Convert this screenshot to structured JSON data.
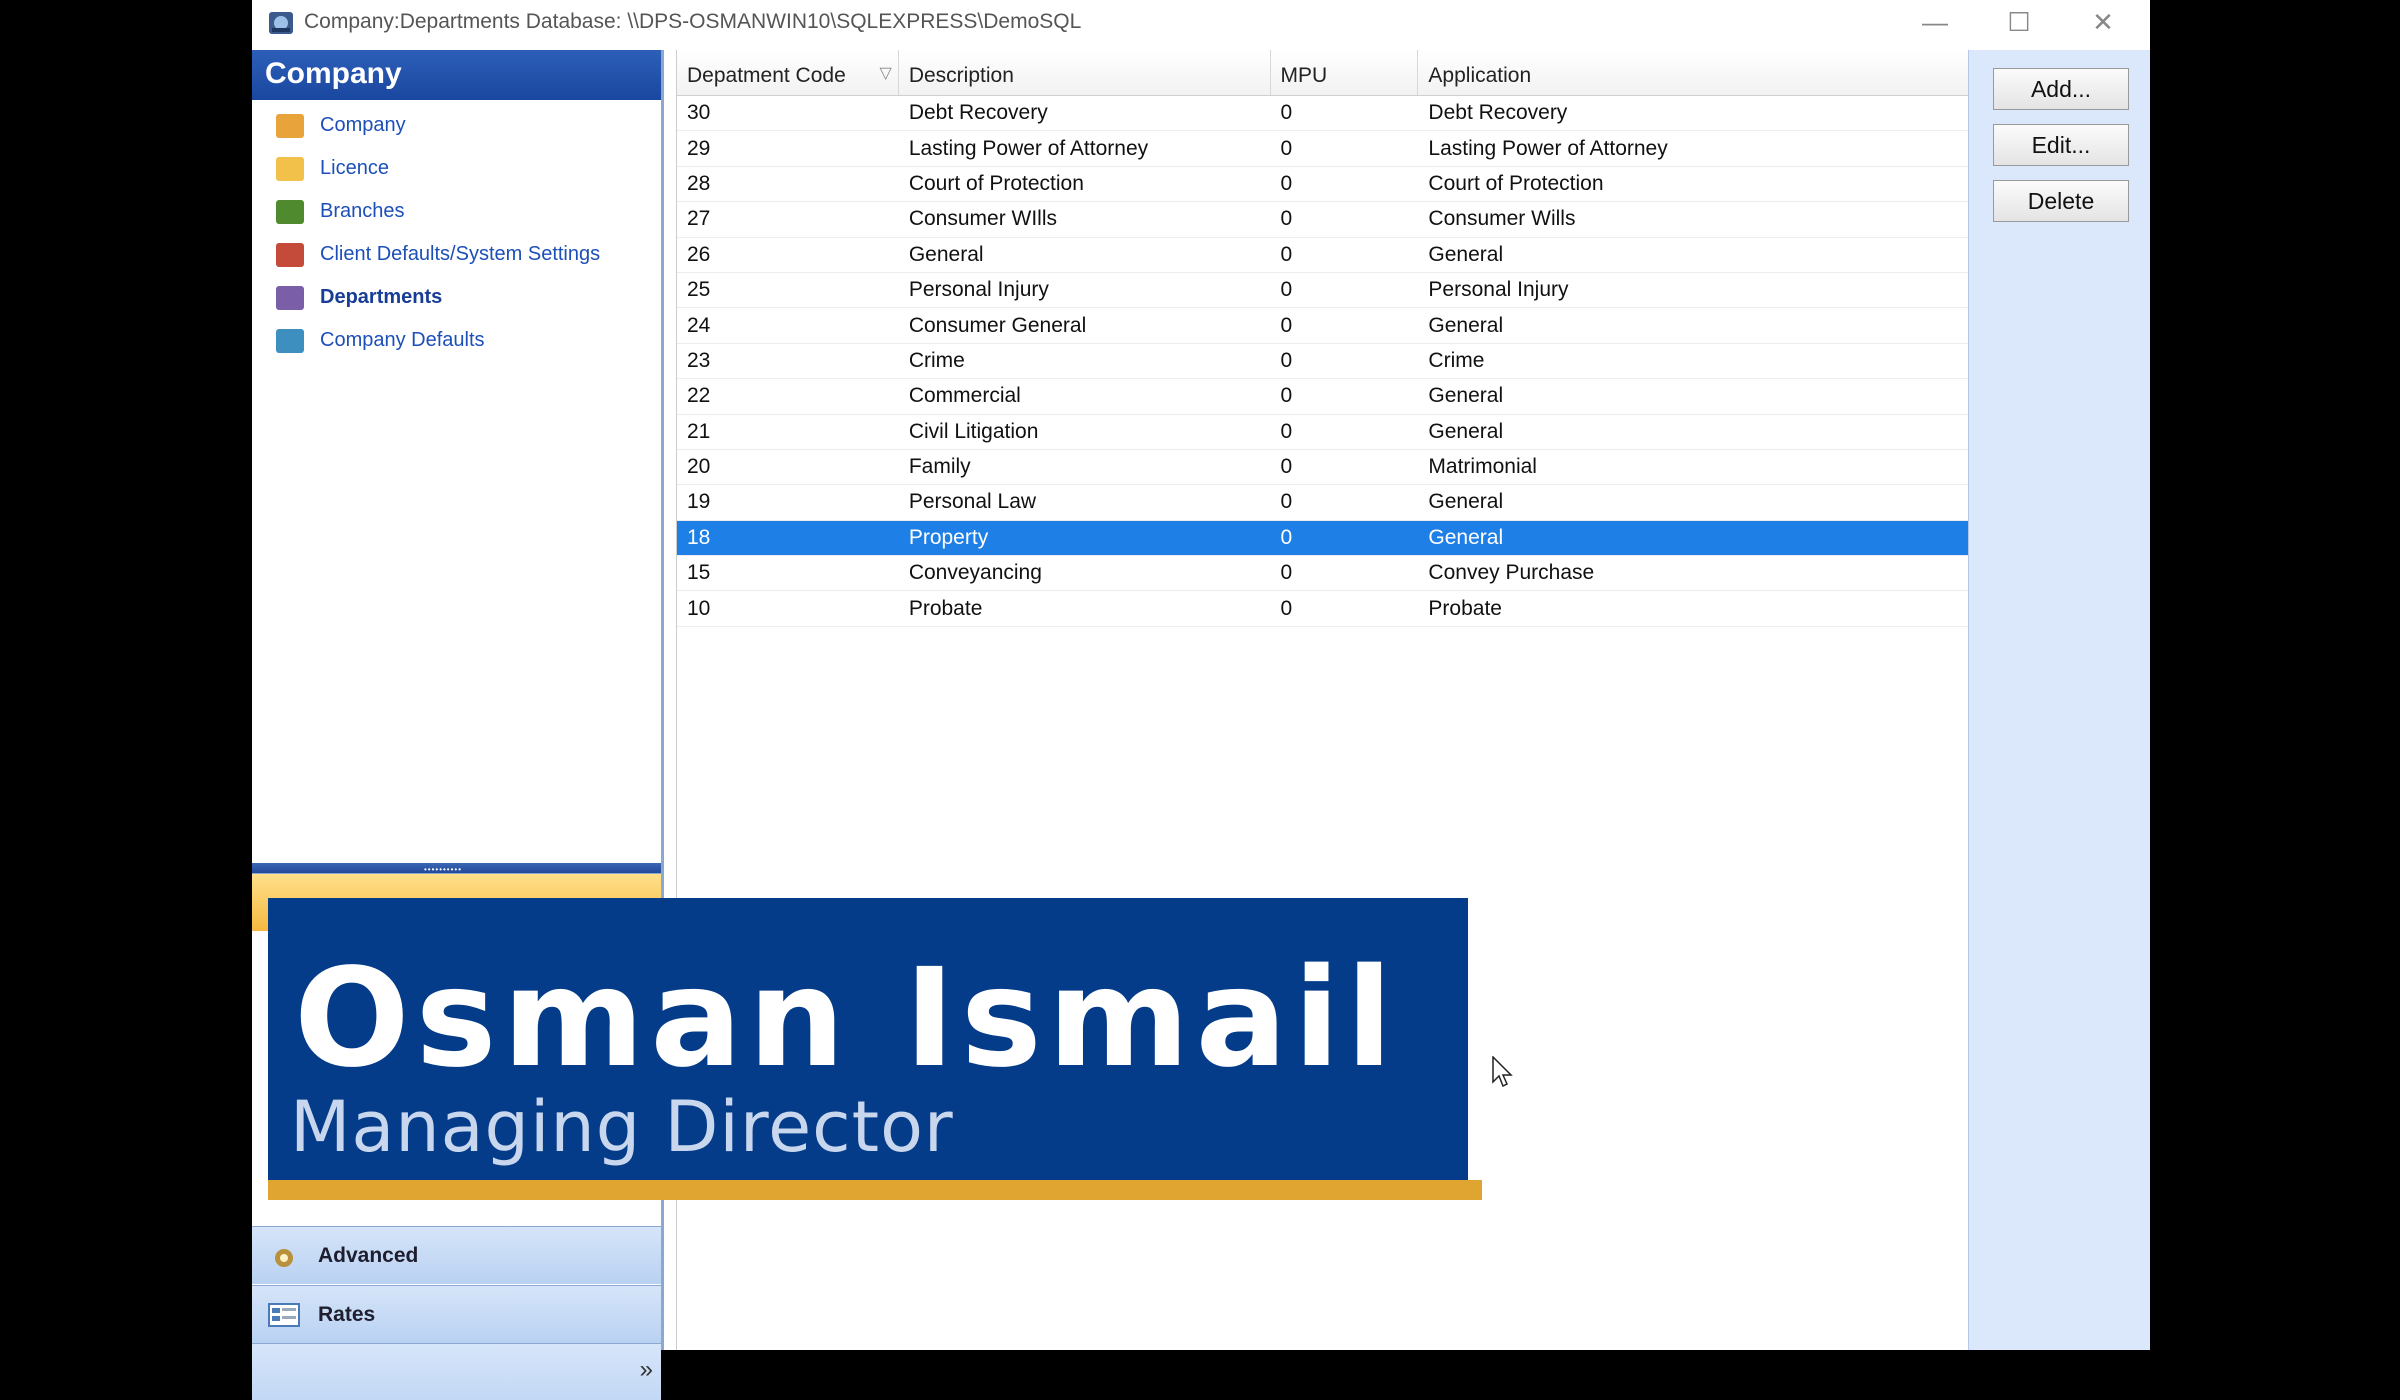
{
  "window": {
    "title": "Company:Departments Database: \\\\DPS-OSMANWIN10\\SQLEXPRESS\\DemoSQL",
    "controls": {
      "minimize": "—",
      "maximize": "☐",
      "close": "✕"
    }
  },
  "nav": {
    "header": "Company",
    "items": [
      {
        "label": "Company",
        "icon": "folder-open-icon",
        "color": "#e8a33b"
      },
      {
        "label": "Licence",
        "icon": "licence-icon",
        "color": "#f2c14a"
      },
      {
        "label": "Branches",
        "icon": "branches-icon",
        "color": "#4f8a2e"
      },
      {
        "label": "Client Defaults/System Settings",
        "icon": "settings-icon",
        "color": "#c44a3a"
      },
      {
        "label": "Departments",
        "icon": "departments-icon",
        "color": "#7a5fa8"
      },
      {
        "label": "Company Defaults",
        "icon": "company-defaults-icon",
        "color": "#3d8fc0"
      }
    ],
    "selected": "Departments",
    "buttons": [
      {
        "label": "Advanced",
        "icon": "advanced-icon"
      },
      {
        "label": "Rates",
        "icon": "rates-icon"
      }
    ],
    "footer_chevron": "»"
  },
  "grid": {
    "columns": [
      "Depatment Code",
      "Description",
      "MPU",
      "Application"
    ],
    "sort_indicator": "▽",
    "rows": [
      [
        "30",
        "Debt Recovery",
        "0",
        "Debt Recovery"
      ],
      [
        "29",
        "Lasting Power of Attorney",
        "0",
        "Lasting Power of Attorney"
      ],
      [
        "28",
        "Court of Protection",
        "0",
        "Court of Protection"
      ],
      [
        "27",
        "Consumer WIlls",
        "0",
        "Consumer Wills"
      ],
      [
        "26",
        "General",
        "0",
        "General"
      ],
      [
        "25",
        "Personal Injury",
        "0",
        "Personal Injury"
      ],
      [
        "24",
        "Consumer General",
        "0",
        "General"
      ],
      [
        "23",
        "Crime",
        "0",
        "Crime"
      ],
      [
        "22",
        "Commercial",
        "0",
        "General"
      ],
      [
        "21",
        "Civil Litigation",
        "0",
        "General"
      ],
      [
        "20",
        "Family",
        "0",
        "Matrimonial"
      ],
      [
        "19",
        "Personal Law",
        "0",
        "General"
      ],
      [
        "18",
        "Property",
        "0",
        "General"
      ],
      [
        "15",
        "Conveyancing",
        "0",
        "Convey Purchase"
      ],
      [
        "10",
        "Probate",
        "0",
        "Probate"
      ]
    ],
    "selected_row": 12
  },
  "actions": {
    "add": "Add...",
    "edit": "Edit...",
    "delete": "Delete"
  },
  "overlay": {
    "name": "Osman Ismail",
    "role": "Managing Director"
  },
  "colors": {
    "selection": "#1e7fe6",
    "overlay_bg": "#053c8a",
    "overlay_bar": "#e0a431",
    "nav_header": "#1a47a0"
  }
}
